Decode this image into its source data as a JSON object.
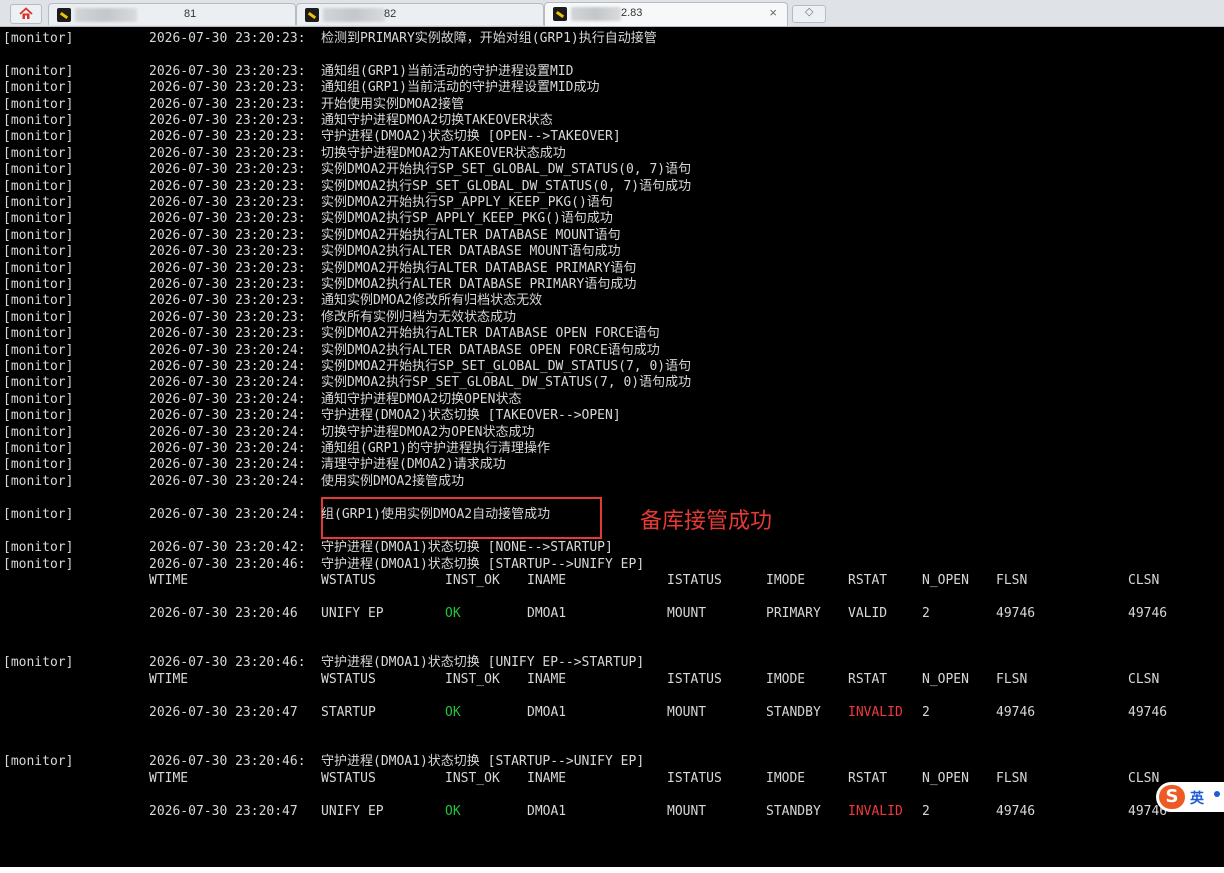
{
  "tabs": [
    {
      "label": "81",
      "active": false
    },
    {
      "label": "82",
      "active": false
    },
    {
      "label": "2.83",
      "active": true
    }
  ],
  "tab_close": "×",
  "newtab_glyph": "◇",
  "colors": {
    "ok": "#21c43a",
    "invalid": "#ef3a3a",
    "annotation": "#e53935",
    "terminal_bg": "#000000"
  },
  "annotation": "备库接管成功",
  "log": [
    {
      "tag": "[monitor]",
      "ts": "2026-07-30 23:20:23:",
      "msg": "检测到PRIMARY实例故障，开始对组(GRP1)执行自动接管"
    },
    {
      "tag": "[monitor]",
      "ts": "2026-07-30 23:20:23:",
      "msg": "通知组(GRP1)当前活动的守护进程设置MID"
    },
    {
      "tag": "[monitor]",
      "ts": "2026-07-30 23:20:23:",
      "msg": "通知组(GRP1)当前活动的守护进程设置MID成功"
    },
    {
      "tag": "[monitor]",
      "ts": "2026-07-30 23:20:23:",
      "msg": "开始使用实例DMOA2接管"
    },
    {
      "tag": "[monitor]",
      "ts": "2026-07-30 23:20:23:",
      "msg": "通知守护进程DMOA2切换TAKEOVER状态"
    },
    {
      "tag": "[monitor]",
      "ts": "2026-07-30 23:20:23:",
      "msg": "守护进程(DMOA2)状态切换 [OPEN-->TAKEOVER]"
    },
    {
      "tag": "[monitor]",
      "ts": "2026-07-30 23:20:23:",
      "msg": "切换守护进程DMOA2为TAKEOVER状态成功"
    },
    {
      "tag": "[monitor]",
      "ts": "2026-07-30 23:20:23:",
      "msg": "实例DMOA2开始执行SP_SET_GLOBAL_DW_STATUS(0, 7)语句"
    },
    {
      "tag": "[monitor]",
      "ts": "2026-07-30 23:20:23:",
      "msg": "实例DMOA2执行SP_SET_GLOBAL_DW_STATUS(0, 7)语句成功"
    },
    {
      "tag": "[monitor]",
      "ts": "2026-07-30 23:20:23:",
      "msg": "实例DMOA2开始执行SP_APPLY_KEEP_PKG()语句"
    },
    {
      "tag": "[monitor]",
      "ts": "2026-07-30 23:20:23:",
      "msg": "实例DMOA2执行SP_APPLY_KEEP_PKG()语句成功"
    },
    {
      "tag": "[monitor]",
      "ts": "2026-07-30 23:20:23:",
      "msg": "实例DMOA2开始执行ALTER DATABASE MOUNT语句"
    },
    {
      "tag": "[monitor]",
      "ts": "2026-07-30 23:20:23:",
      "msg": "实例DMOA2执行ALTER DATABASE MOUNT语句成功"
    },
    {
      "tag": "[monitor]",
      "ts": "2026-07-30 23:20:23:",
      "msg": "实例DMOA2开始执行ALTER DATABASE PRIMARY语句"
    },
    {
      "tag": "[monitor]",
      "ts": "2026-07-30 23:20:23:",
      "msg": "实例DMOA2执行ALTER DATABASE PRIMARY语句成功"
    },
    {
      "tag": "[monitor]",
      "ts": "2026-07-30 23:20:23:",
      "msg": "通知实例DMOA2修改所有归档状态无效"
    },
    {
      "tag": "[monitor]",
      "ts": "2026-07-30 23:20:23:",
      "msg": "修改所有实例归档为无效状态成功"
    },
    {
      "tag": "[monitor]",
      "ts": "2026-07-30 23:20:23:",
      "msg": "实例DMOA2开始执行ALTER DATABASE OPEN FORCE语句"
    },
    {
      "tag": "[monitor]",
      "ts": "2026-07-30 23:20:24:",
      "msg": "实例DMOA2执行ALTER DATABASE OPEN FORCE语句成功"
    },
    {
      "tag": "[monitor]",
      "ts": "2026-07-30 23:20:24:",
      "msg": "实例DMOA2开始执行SP_SET_GLOBAL_DW_STATUS(7, 0)语句"
    },
    {
      "tag": "[monitor]",
      "ts": "2026-07-30 23:20:24:",
      "msg": "实例DMOA2执行SP_SET_GLOBAL_DW_STATUS(7, 0)语句成功"
    },
    {
      "tag": "[monitor]",
      "ts": "2026-07-30 23:20:24:",
      "msg": "通知守护进程DMOA2切换OPEN状态"
    },
    {
      "tag": "[monitor]",
      "ts": "2026-07-30 23:20:24:",
      "msg": "守护进程(DMOA2)状态切换 [TAKEOVER-->OPEN]"
    },
    {
      "tag": "[monitor]",
      "ts": "2026-07-30 23:20:24:",
      "msg": "切换守护进程DMOA2为OPEN状态成功"
    },
    {
      "tag": "[monitor]",
      "ts": "2026-07-30 23:20:24:",
      "msg": "通知组(GRP1)的守护进程执行清理操作"
    },
    {
      "tag": "[monitor]",
      "ts": "2026-07-30 23:20:24:",
      "msg": "清理守护进程(DMOA2)请求成功"
    },
    {
      "tag": "[monitor]",
      "ts": "2026-07-30 23:20:24:",
      "msg": "使用实例DMOA2接管成功"
    },
    {
      "tag": "[monitor]",
      "ts": "2026-07-30 23:20:24:",
      "msg": "组(GRP1)使用实例DMOA2自动接管成功"
    },
    {
      "tag": "[monitor]",
      "ts": "2026-07-30 23:20:42:",
      "msg": "守护进程(DMOA1)状态切换 [NONE-->STARTUP]"
    },
    {
      "tag": "[monitor]",
      "ts": "2026-07-30 23:20:46:",
      "msg": "守护进程(DMOA1)状态切换 [STARTUP-->UNIFY EP]"
    },
    {
      "tag": "[monitor]",
      "ts": "2026-07-30 23:20:46:",
      "msg": "守护进程(DMOA1)状态切换 [UNIFY EP-->STARTUP]"
    },
    {
      "tag": "[monitor]",
      "ts": "2026-07-30 23:20:46:",
      "msg": "守护进程(DMOA1)状态切换 [STARTUP-->UNIFY EP]"
    }
  ],
  "table_headers": [
    "WTIME",
    "WSTATUS",
    "INST_OK",
    "INAME",
    "ISTATUS",
    "IMODE",
    "RSTAT",
    "N_OPEN",
    "FLSN",
    "CLSN"
  ],
  "tables": [
    {
      "WTIME": "2026-07-30 23:20:46",
      "WSTATUS": "UNIFY EP",
      "INST_OK": "OK",
      "INAME": "DMOA1",
      "ISTATUS": "MOUNT",
      "IMODE": "PRIMARY",
      "RSTAT": "VALID",
      "N_OPEN": "2",
      "FLSN": "49746",
      "CLSN": "49746"
    },
    {
      "WTIME": "2026-07-30 23:20:47",
      "WSTATUS": "STARTUP",
      "INST_OK": "OK",
      "INAME": "DMOA1",
      "ISTATUS": "MOUNT",
      "IMODE": "STANDBY",
      "RSTAT": "INVALID",
      "N_OPEN": "2",
      "FLSN": "49746",
      "CLSN": "49746"
    },
    {
      "WTIME": "2026-07-30 23:20:47",
      "WSTATUS": "UNIFY EP",
      "INST_OK": "OK",
      "INAME": "DMOA1",
      "ISTATUS": "MOUNT",
      "IMODE": "STANDBY",
      "RSTAT": "INVALID",
      "N_OPEN": "2",
      "FLSN": "49746",
      "CLSN": "49746"
    }
  ],
  "ime": {
    "logo": "S",
    "lang": "英"
  }
}
